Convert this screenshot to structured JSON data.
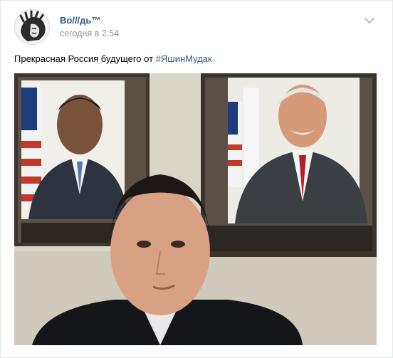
{
  "post": {
    "author": "Во///дь™",
    "time": "сегодня в 2:54",
    "text_prefix": "Прекрасная Россия будущего от ",
    "hashtag": "#ЯшинМудак"
  },
  "icons": {
    "avatar": "avatar-icon",
    "menu": "chevron-down-icon"
  },
  "colors": {
    "link": "#2a5885",
    "secondary_text": "#939393",
    "border": "#e7e8ec"
  }
}
